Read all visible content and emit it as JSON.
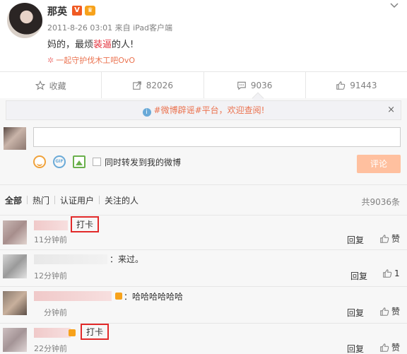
{
  "post": {
    "author": "那英",
    "verified_badge": "V",
    "vip_badge": "♛",
    "timestamp": "2011-8-26 03:01",
    "source": "来自 iPad客户端",
    "content_before": "妈的，最烦",
    "content_highlight": "装逼",
    "content_after": "的人!",
    "topic": "一起守护伐木工吧OvO",
    "menu_icon": "chevron-down-icon"
  },
  "actions": {
    "favorite": "收藏",
    "repost": "82026",
    "comments": "9036",
    "likes": "91443"
  },
  "notice": {
    "link": "#微博辟谣#平台，",
    "text": "欢迎查阅!",
    "close": "×"
  },
  "composer": {
    "checkbox_label": "同时转发到我的微博",
    "submit": "评论",
    "gif_label": "GIF"
  },
  "tabs": {
    "items": [
      "全部",
      "热门",
      "认证用户",
      "关注的人"
    ],
    "total": "共9036条"
  },
  "comments": [
    {
      "text": "打卡",
      "time": "11分钟前",
      "reply": "回复",
      "likes": "赞"
    },
    {
      "text": "：来过。",
      "time": "12分钟前",
      "reply": "回复",
      "likes": "1"
    },
    {
      "text": "：哈哈哈哈哈哈",
      "time": "分钟前",
      "reply": "回复",
      "likes": "赞"
    },
    {
      "text": "打卡",
      "time": "22分钟前",
      "reply": "回复",
      "likes": "赞"
    }
  ],
  "colors": {
    "accent": "#eb7350",
    "highlight": "#e3333e",
    "annotation_box": "#e22a2a",
    "submit_disabled": "#ffc09f"
  }
}
